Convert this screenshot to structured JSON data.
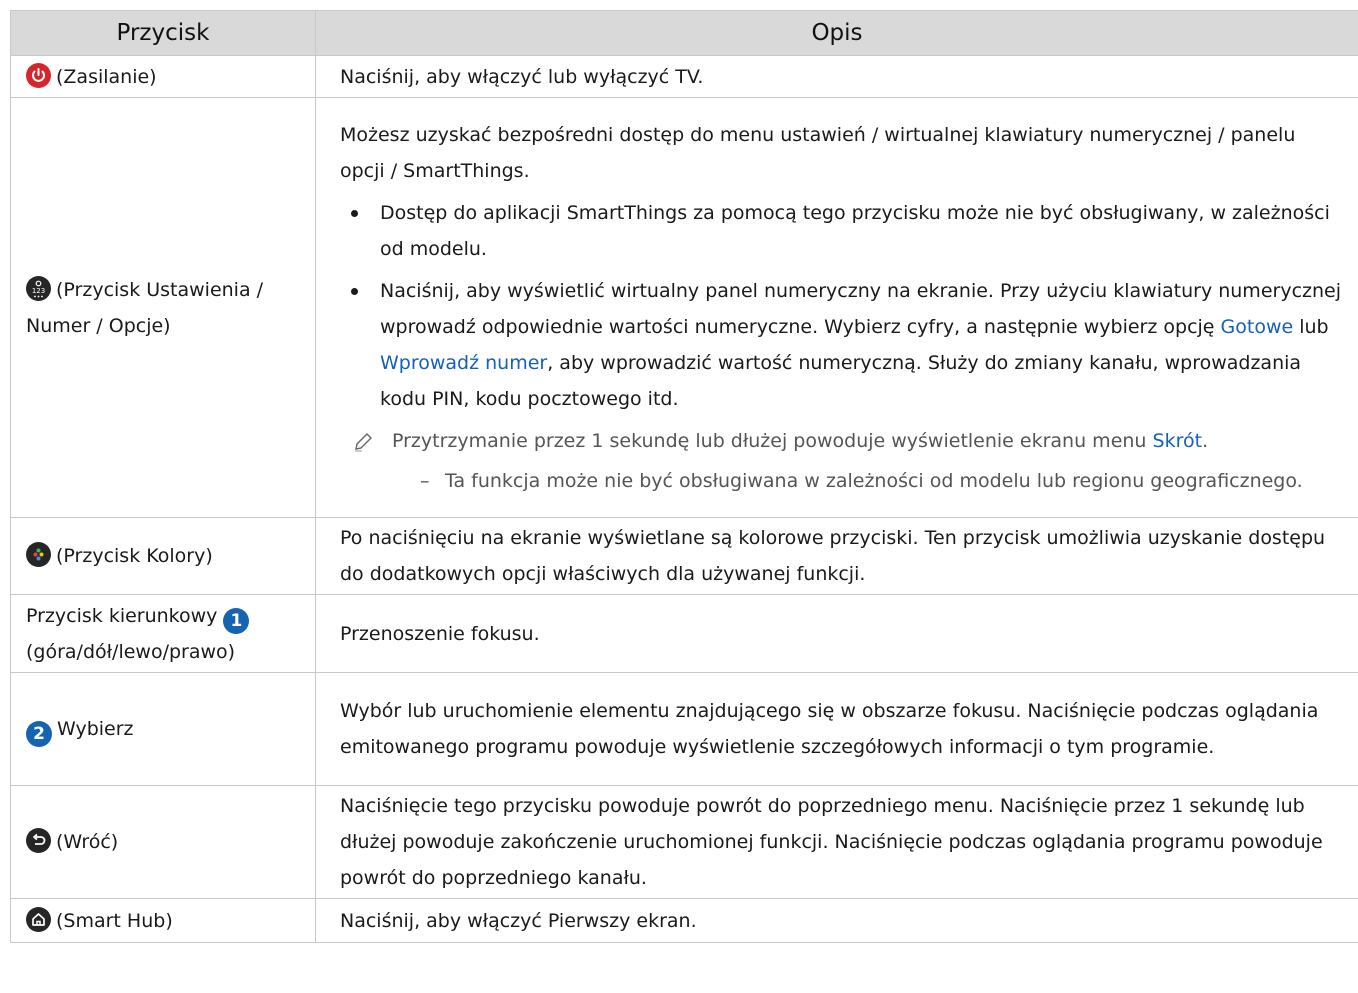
{
  "header": {
    "col1": "Przycisk",
    "col2": "Opis"
  },
  "rows": {
    "power": {
      "label": "(Zasilanie)",
      "desc": "Naciśnij, aby włączyć lub wyłączyć TV."
    },
    "settings": {
      "label": "(Przycisk Ustawienia / Numer / Opcje)",
      "intro": "Możesz uzyskać bezpośredni dostęp do menu ustawień / wirtualnej klawiatury numerycznej / panelu opcji / SmartThings.",
      "bullet1": "Dostęp do aplikacji SmartThings za pomocą tego przycisku może nie być obsługiwany, w zależności od modelu.",
      "bullet2_a": "Naciśnij, aby wyświetlić wirtualny panel numeryczny na ekranie. Przy użyciu klawiatury numerycznej wprowadź odpowiednie wartości numeryczne. Wybierz cyfry, a następnie wybierz opcję ",
      "bullet2_link1": "Gotowe",
      "bullet2_b": " lub ",
      "bullet2_link2": "Wprowadź numer",
      "bullet2_c": ", aby wprowadzić wartość numeryczną. Służy do zmiany kanału, wprowadzania kodu PIN, kodu pocztowego itd.",
      "note_a": "Przytrzymanie przez 1 sekundę lub dłużej powoduje wyświetlenie ekranu menu ",
      "note_link": "Skrót",
      "note_b": ".",
      "subnote": "Ta funkcja może nie być obsługiwana w zależności od modelu lub regionu geograficznego."
    },
    "colors": {
      "label": "(Przycisk Kolory)",
      "desc": "Po naciśnięciu na ekranie wyświetlane są kolorowe przyciski. Ten przycisk umożliwia uzyskanie dostępu do dodatkowych opcji właściwych dla używanej funkcji."
    },
    "direction": {
      "label_a": "Przycisk kierunkowy",
      "badge": "1",
      "label_b": "(góra/dół/lewo/prawo)",
      "desc": "Przenoszenie fokusu."
    },
    "select": {
      "badge": "2",
      "label": "Wybierz",
      "desc": "Wybór lub uruchomienie elementu znajdującego się w obszarze fokusu. Naciśnięcie podczas oglądania emitowanego programu powoduje wyświetlenie szczegółowych informacji o tym programie."
    },
    "back": {
      "label": "(Wróć)",
      "desc": "Naciśnięcie tego przycisku powoduje powrót do poprzedniego menu. Naciśnięcie przez 1 sekundę lub dłużej powoduje zakończenie uruchomionej funkcji. Naciśnięcie podczas oglądania programu powoduje powrót do poprzedniego kanału."
    },
    "home": {
      "label": "(Smart Hub)",
      "desc": "Naciśnij, aby włączyć Pierwszy ekran."
    }
  },
  "colors": {
    "header_bg": "#d9d9d9",
    "link": "#1560b8",
    "power_icon": "#d7262b",
    "badge": "#1564b2"
  },
  "icons": [
    "power-icon",
    "settings-number-icon",
    "color-buttons-icon",
    "direction-badge-1",
    "select-badge-2",
    "back-icon",
    "home-icon",
    "pencil-note-icon"
  ]
}
